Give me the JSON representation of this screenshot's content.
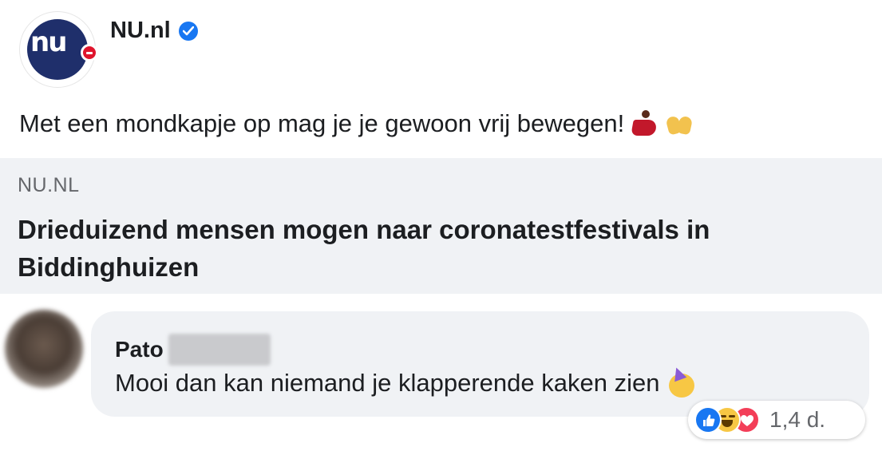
{
  "post": {
    "page_name": "NU.nl",
    "logo_text": "nu",
    "verified_icon": "verified-badge-icon",
    "text": "Met een mondkapje op mag je je gewoon vrij bewegen!",
    "emojis": [
      "dancer-emoji",
      "clapping-hands-emoji"
    ]
  },
  "link_preview": {
    "domain": "NU.NL",
    "title": "Drieduizend mensen mogen naar coronatestfestivals in Biddinghuizen"
  },
  "comment": {
    "author_name": "Pato",
    "author_name_redacted": true,
    "text": "Mooi dan kan niemand je klapperende kaken zien",
    "emoji": "partying-face-emoji",
    "reactions": [
      "like",
      "haha",
      "love"
    ],
    "reaction_count": "1,4 d."
  },
  "colors": {
    "nu_blue": "#1f2f6b",
    "nu_red": "#e0152d",
    "facebook_blue": "#1877f2",
    "bubble_gray": "#f0f2f5",
    "secondary_text": "#65676b"
  }
}
